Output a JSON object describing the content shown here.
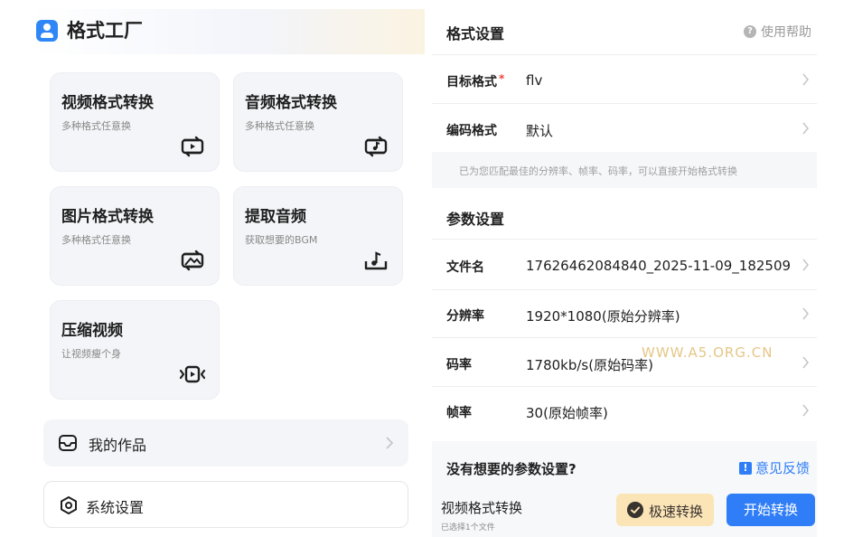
{
  "app": {
    "title": "格式工厂"
  },
  "cards": [
    {
      "title": "视频格式转换",
      "subtitle": "多种格式任意换",
      "icon": "video-convert-icon"
    },
    {
      "title": "音频格式转换",
      "subtitle": "多种格式任意换",
      "icon": "audio-convert-icon"
    },
    {
      "title": "图片格式转换",
      "subtitle": "多种格式任意换",
      "icon": "image-convert-icon"
    },
    {
      "title": "提取音频",
      "subtitle": "获取想要的BGM",
      "icon": "extract-audio-icon"
    },
    {
      "title": "压缩视频",
      "subtitle": "让视频瘦个身",
      "icon": "compress-video-icon"
    }
  ],
  "menu": {
    "works_label": "我的作品",
    "settings_label": "系统设置"
  },
  "format_settings": {
    "title": "格式设置",
    "help_label": "使用帮助",
    "target_format_label": "目标格式",
    "target_format_required": "*",
    "target_format_value": "flv",
    "codec_label": "编码格式",
    "codec_value": "默认",
    "hint": "已为您匹配最佳的分辨率、帧率、码率，可以直接开始格式转换"
  },
  "param_settings": {
    "title": "参数设置",
    "rows": [
      {
        "label": "文件名",
        "value": "17626462084840_2025-11-09_182509"
      },
      {
        "label": "分辨率",
        "value": "1920*1080(原始分辨率)"
      },
      {
        "label": "码率",
        "value": "1780kb/s(原始码率)"
      },
      {
        "label": "帧率",
        "value": "30(原始帧率)"
      }
    ]
  },
  "watermark": "WWW.A5.ORG.CN",
  "footer": {
    "no_params_text": "没有想要的参数设置?",
    "feedback_icon": "!",
    "feedback_label": "意见反馈",
    "task_title": "视频格式转换",
    "task_subtitle": "已选择1个文件",
    "fast_label": "极速转换",
    "start_label": "开始转换"
  },
  "colors": {
    "accent": "#2f7ef7",
    "required": "#f04343",
    "fast_bg": "#fbe4b6",
    "card_bg": "#f4f5f8"
  }
}
